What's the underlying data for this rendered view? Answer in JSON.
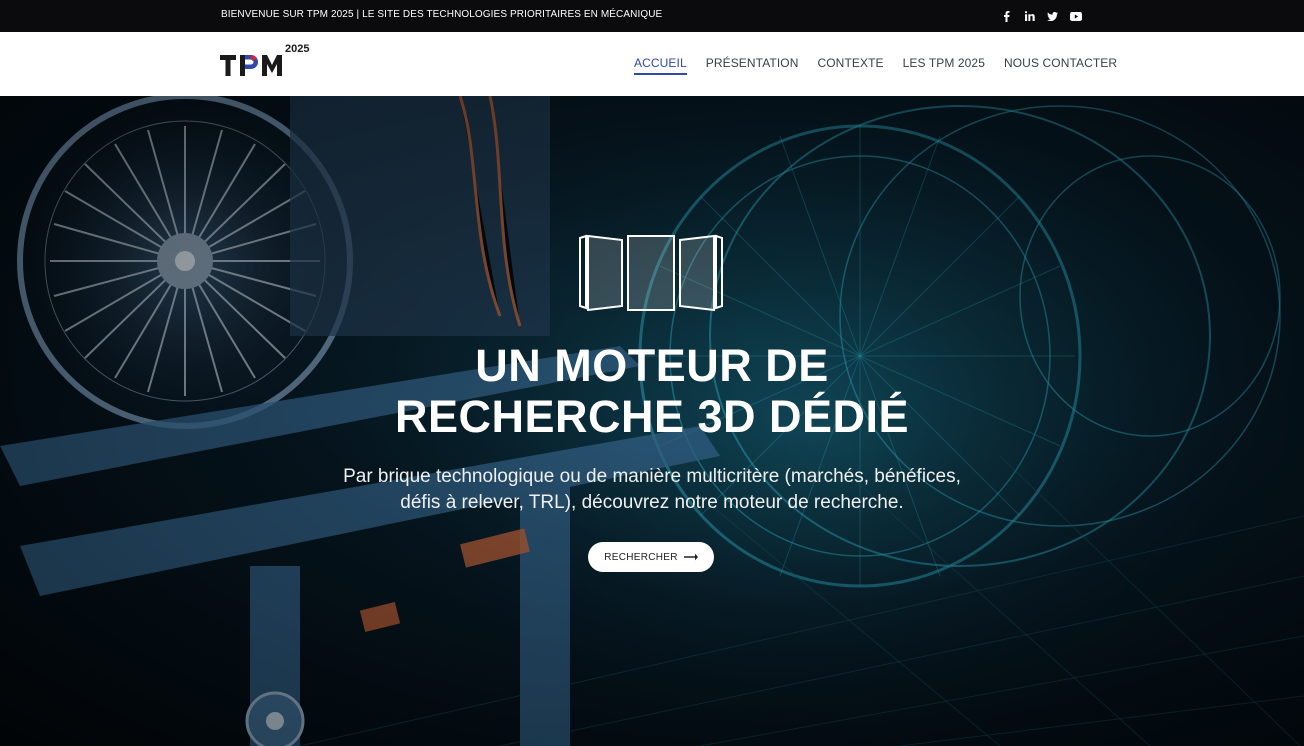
{
  "topbar": {
    "announcement": "BIENVENUE SUR TPM 2025 | LE SITE DES TECHNOLOGIES PRIORITAIRES EN MÉCANIQUE",
    "socials": [
      {
        "icon": "facebook-icon",
        "glyph": "f"
      },
      {
        "icon": "linkedin-icon",
        "glyph": "in"
      },
      {
        "icon": "twitter-icon",
        "glyph": "t"
      },
      {
        "icon": "youtube-icon",
        "glyph": "yt"
      }
    ]
  },
  "header": {
    "logo": {
      "text": "TPM",
      "year": "2025"
    },
    "nav": [
      {
        "label": "ACCUEIL",
        "active": true
      },
      {
        "label": "PRÉSENTATION",
        "active": false
      },
      {
        "label": "CONTEXTE",
        "active": false
      },
      {
        "label": "LES TPM 2025",
        "active": false
      },
      {
        "label": "NOUS CONTACTER",
        "active": false
      }
    ]
  },
  "hero": {
    "title_line1": "UN MOTEUR DE",
    "title_line2": "RECHERCHE 3D DÉDIÉ",
    "subtitle_line1": "Par brique technologique ou de manière multicritère (marchés, bénéfices,",
    "subtitle_line2": "défis à relever, TRL), découvrez notre moteur de recherche.",
    "cta_label": "RECHERCHER",
    "cta_icon": "arrow-right-icon"
  },
  "colors": {
    "topbar_bg": "#0b0b0d",
    "nav_active": "#2f4aa8",
    "logo_dark": "#1a1a1a",
    "logo_blue": "#2f4aa8",
    "logo_red": "#d1273a"
  }
}
